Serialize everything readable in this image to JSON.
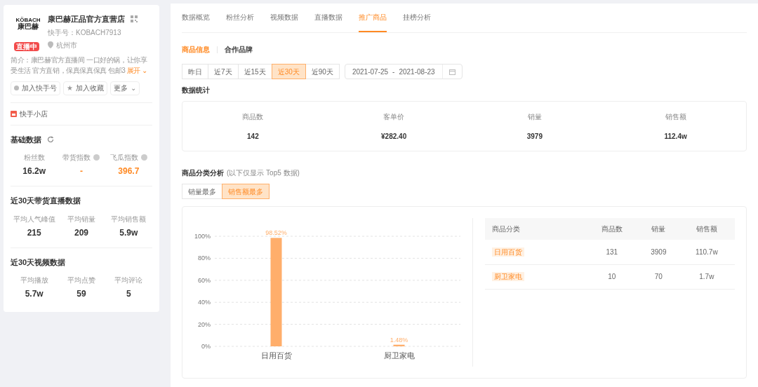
{
  "profile": {
    "logo_lines": [
      "KÖBACH",
      "康巴赫"
    ],
    "live_badge": "直播中",
    "name": "康巴赫正品官方直营店",
    "account": "快手号：KOBACH7913",
    "location": "杭州市",
    "intro_lines": [
      "简介：康巴赫官方直播间 一口好的锅，让你享",
      "受生活 官方直销，保真保真保真 包邮3"
    ],
    "expand": "展开",
    "expand_caret": "⌄",
    "actions": [
      {
        "kind": "dot",
        "label": "加入快手号"
      },
      {
        "kind": "star",
        "label": "加入收藏",
        "icon": "★"
      },
      {
        "kind": "menu",
        "label": "更多",
        "icon": "⌄"
      }
    ],
    "shop": "快手小店"
  },
  "basic": {
    "title": "基础数据",
    "stats": [
      {
        "label": "粉丝数",
        "value": "16.2w",
        "info": false,
        "highlight": false
      },
      {
        "label": "带货指数",
        "value": "-",
        "info": true,
        "highlight": true
      },
      {
        "label": "飞瓜指数",
        "value": "396.7",
        "info": true,
        "highlight": true
      }
    ]
  },
  "live30": {
    "title": "近30天带货直播数据",
    "stats": [
      {
        "label": "平均人气峰值",
        "value": "215"
      },
      {
        "label": "平均销量",
        "value": "209"
      },
      {
        "label": "平均销售额",
        "value": "5.9w"
      }
    ]
  },
  "video30": {
    "title": "近30天视频数据",
    "stats": [
      {
        "label": "平均播放",
        "value": "5.7w"
      },
      {
        "label": "平均点赞",
        "value": "59"
      },
      {
        "label": "平均评论",
        "value": "5"
      }
    ]
  },
  "tabs": [
    {
      "label": "数据概览",
      "selected": false
    },
    {
      "label": "粉丝分析",
      "selected": false
    },
    {
      "label": "视频数据",
      "selected": false
    },
    {
      "label": "直播数据",
      "selected": false
    },
    {
      "label": "推广商品",
      "selected": true
    },
    {
      "label": "挂榜分析",
      "selected": false
    }
  ],
  "subtabs": [
    {
      "label": "商品信息",
      "selected": true
    },
    {
      "label": "合作品牌",
      "selected": false
    }
  ],
  "ranges": [
    {
      "label": "昨日",
      "selected": false
    },
    {
      "label": "近7天",
      "selected": false
    },
    {
      "label": "近15天",
      "selected": false
    },
    {
      "label": "近30天",
      "selected": true
    },
    {
      "label": "近90天",
      "selected": false
    }
  ],
  "date_range": {
    "start": "2021-07-25",
    "separator": "-",
    "end": "2021-08-23"
  },
  "summary": {
    "title": "数据统计",
    "stats": [
      {
        "label": "商品数",
        "value": "142"
      },
      {
        "label": "客单价",
        "value": "¥282.40"
      },
      {
        "label": "销量",
        "value": "3979"
      },
      {
        "label": "销售额",
        "value": "112.4w"
      }
    ]
  },
  "category": {
    "title": "商品分类分析",
    "note": "(以下仅显示 Top5 数据)",
    "toggles": [
      {
        "label": "销量最多",
        "selected": false
      },
      {
        "label": "销售额最多",
        "selected": true
      }
    ],
    "chart_data": {
      "type": "bar",
      "categories": [
        "日用百货",
        "厨卫家电"
      ],
      "series": [
        {
          "color": "#ffae6b",
          "values": [
            98.52,
            1.48
          ]
        }
      ],
      "grid": true,
      "ylim": [
        0,
        100
      ],
      "yticks": [
        {
          "value": 0,
          "label": "0%"
        },
        {
          "value": 20,
          "label": "20%"
        },
        {
          "value": 40,
          "label": "40%"
        },
        {
          "value": 60,
          "label": "60%"
        },
        {
          "value": 80,
          "label": "80%"
        },
        {
          "value": 100,
          "label": "100%"
        }
      ],
      "value_labels": [
        "98.52%",
        "1.48%"
      ]
    },
    "table": {
      "columns": [
        "商品分类",
        "商品数",
        "销量",
        "销售额"
      ],
      "rows": [
        [
          "日用百货",
          "131",
          "3909",
          "110.7w"
        ],
        [
          "厨卫家电",
          "10",
          "70",
          "1.7w"
        ]
      ]
    }
  }
}
